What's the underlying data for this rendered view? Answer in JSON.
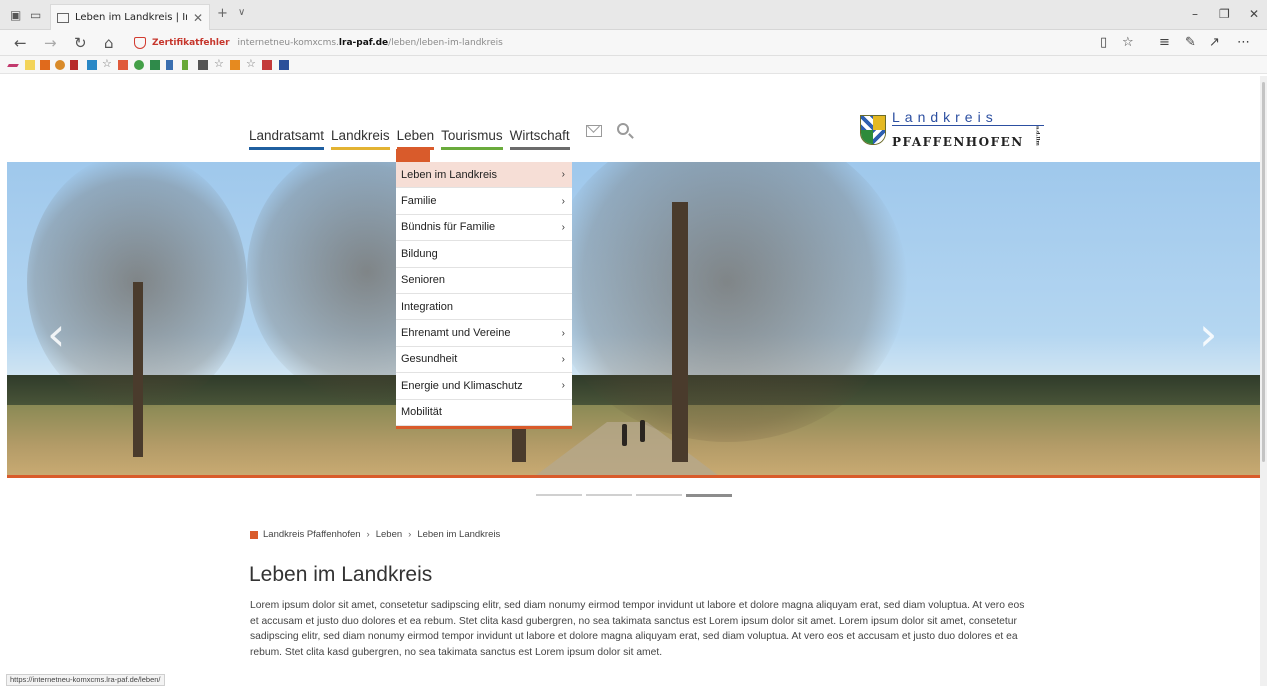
{
  "browser": {
    "tab_title": "Leben im Landkreis | In",
    "tab_close": "✕",
    "new_tab": "+",
    "tab_list": "∨",
    "cert_error": "Zertifikatfehler",
    "url_prefix": "internetneu-komxcms.",
    "url_domain": "lra-paf.de",
    "url_path": "/leben/leben-im-landkreis",
    "status_url": "https://internetneu-komxcms.lra-paf.de/leben/",
    "icons": {
      "back": "←",
      "forward": "→",
      "refresh": "↻",
      "home": "⌂",
      "reading_view": "📖",
      "favorite": "☆",
      "hub": "≡",
      "notes": "✎",
      "share": "↗",
      "more": "⋯",
      "minimize": "–",
      "maximize": "❐",
      "close": "✕"
    }
  },
  "site": {
    "nav": [
      {
        "label": "Landratsamt",
        "color": "#1f5fa0"
      },
      {
        "label": "Landkreis",
        "color": "#e3b332"
      },
      {
        "label": "Leben",
        "color": "#d95b2b"
      },
      {
        "label": "Tourismus",
        "color": "#6aab3c"
      },
      {
        "label": "Wirtschaft",
        "color": "#6b6b6b"
      }
    ],
    "logo": {
      "line1": "Landkreis",
      "line2": "PFAFFENHOFEN",
      "suffix": "a.d.Ilm"
    },
    "accent": "#d95b2b"
  },
  "dropdown": [
    {
      "label": "Leben im Landkreis",
      "has_sub": true,
      "active": true
    },
    {
      "label": "Familie",
      "has_sub": true
    },
    {
      "label": "Bündnis für Familie",
      "has_sub": true
    },
    {
      "label": "Bildung",
      "has_sub": false
    },
    {
      "label": "Senioren",
      "has_sub": false
    },
    {
      "label": "Integration",
      "has_sub": false
    },
    {
      "label": "Ehrenamt und Vereine",
      "has_sub": true
    },
    {
      "label": "Gesundheit",
      "has_sub": true
    },
    {
      "label": "Energie und Klimaschutz",
      "has_sub": true
    },
    {
      "label": "Mobilität",
      "has_sub": false
    }
  ],
  "hero": {
    "prev": "‹",
    "next": "›",
    "slides": 4,
    "active_slide": 4
  },
  "breadcrumb": [
    "Landkreis Pfaffenhofen",
    "Leben",
    "Leben im Landkreis"
  ],
  "breadcrumb_sep": "›",
  "content": {
    "title": "Leben im Landkreis",
    "body": "Lorem ipsum dolor sit amet, consetetur sadipscing elitr, sed diam nonumy eirmod tempor invidunt ut labore et dolore magna aliquyam erat, sed diam voluptua. At vero eos et accusam et justo duo dolores et ea rebum. Stet clita kasd gubergren, no sea takimata sanctus est Lorem ipsum dolor sit amet. Lorem ipsum dolor sit amet, consetetur sadipscing elitr, sed diam nonumy eirmod tempor invidunt ut labore et dolore magna aliquyam erat, sed diam voluptua. At vero eos et accusam et justo duo dolores et ea rebum. Stet clita kasd gubergren, no sea takimata sanctus est Lorem ipsum dolor sit amet."
  }
}
